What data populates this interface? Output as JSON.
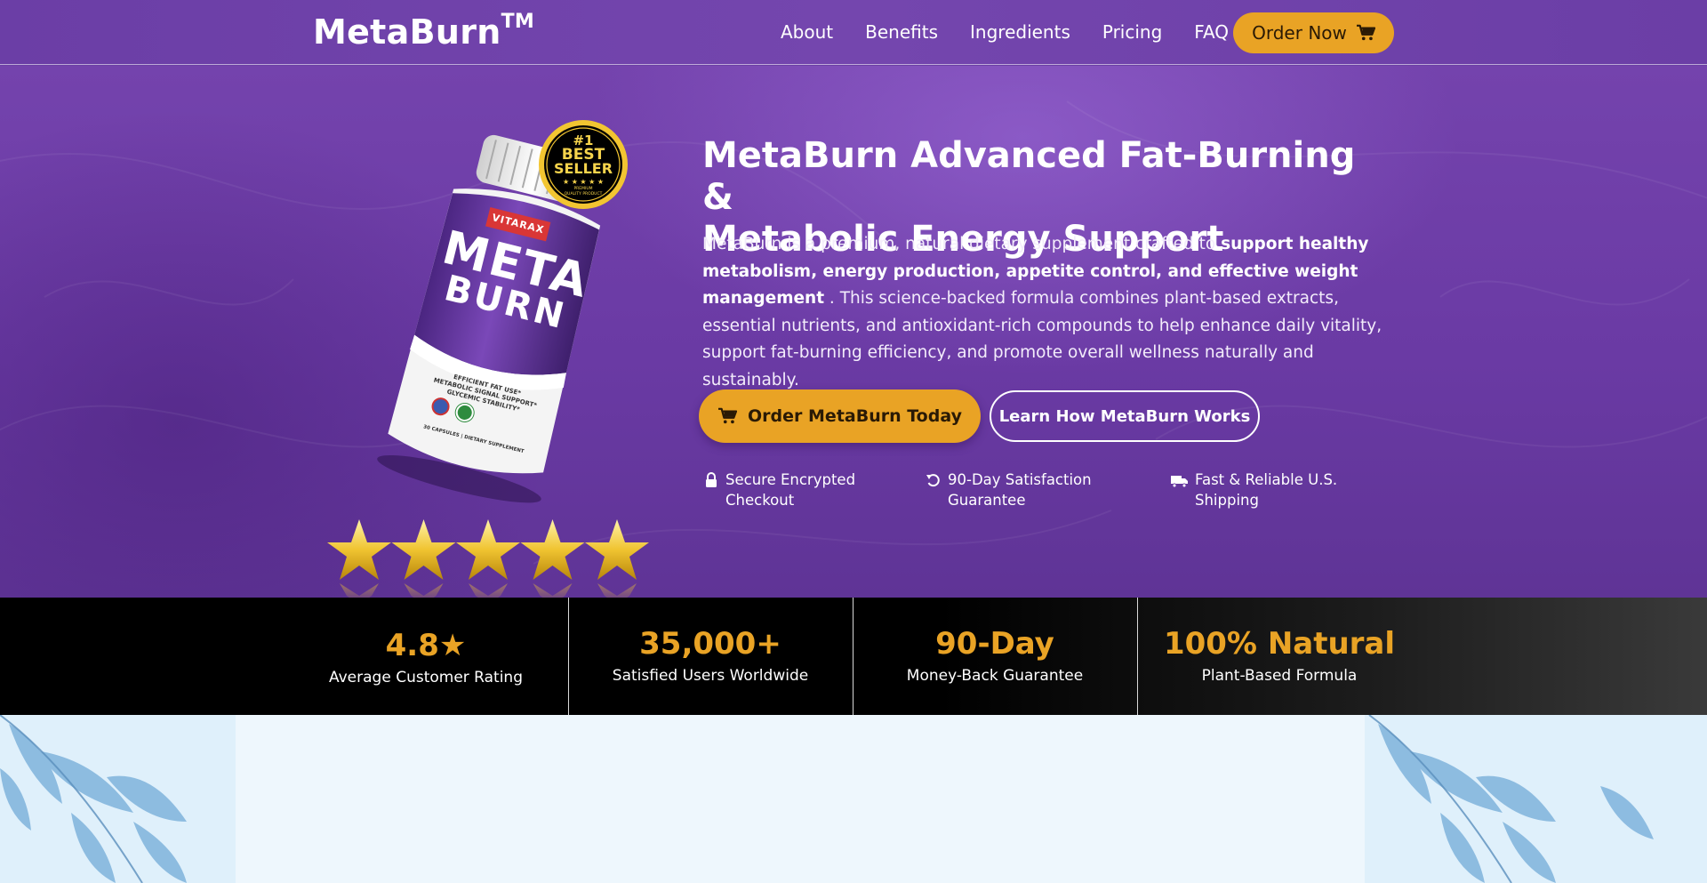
{
  "nav": {
    "brand": "MetaBurn",
    "brand_mark": "TM",
    "links": [
      "About",
      "Benefits",
      "Ingredients",
      "Pricing",
      "FAQ"
    ],
    "order_label": "Order Now",
    "order_icon": "cart-icon"
  },
  "hero": {
    "headline_line1": "MetaBurn Advanced Fat-Burning &",
    "headline_line2": "Metabolic Energy Support",
    "desc_intro": "MetaBurn is a premium, natural dietary supplement crafted to ",
    "desc_bold": "support healthy metabolism, energy production, appetite control, and effective weight management",
    "desc_rest": " . This science-backed formula combines plant-based extracts, essential nutrients, and antioxidant-rich compounds to help enhance daily vitality, support fat-burning efficiency, and promote overall wellness naturally and sustainably.",
    "cta_primary": "Order MetaBurn Today",
    "cta_secondary": "Learn How MetaBurn Works",
    "trust": [
      {
        "icon": "lock-icon",
        "line1": "Secure Encrypted",
        "line2": "Checkout"
      },
      {
        "icon": "refresh-icon",
        "line1": "90-Day Satisfaction",
        "line2": "Guarantee"
      },
      {
        "icon": "truck-icon",
        "line1": "Fast & Reliable U.S.",
        "line2": "Shipping"
      }
    ],
    "bottle": {
      "brand_band": "VITARAX",
      "name_line1": "META",
      "name_line2": "BURN",
      "claims": [
        "EFFICIENT FAT USE*",
        "METABOLIC SIGNAL SUPPORT*",
        "GLYCEMIC STABILITY*"
      ],
      "footer": "30 CAPSULES | DIETARY SUPPLEMENT"
    },
    "badge": {
      "line1": "#1",
      "line2": "BEST",
      "line3": "SELLER",
      "stars": "★ ★ ★ ★ ★",
      "sub1": "PREMIUM",
      "sub2": "QUALITY PRODUCT"
    },
    "rating_stars": 5
  },
  "stats": [
    {
      "value": "4.8★",
      "label": "Average Customer Rating"
    },
    {
      "value": "35,000+",
      "label": "Satisfied Users Worldwide"
    },
    {
      "value": "90-Day",
      "label": "Money-Back Guarantee"
    },
    {
      "value": "100% Natural",
      "label": "Plant-Based Formula"
    }
  ],
  "colors": {
    "accent": "#e9a325",
    "purple": "#6b3ea6",
    "stats_bg": "#000000"
  }
}
